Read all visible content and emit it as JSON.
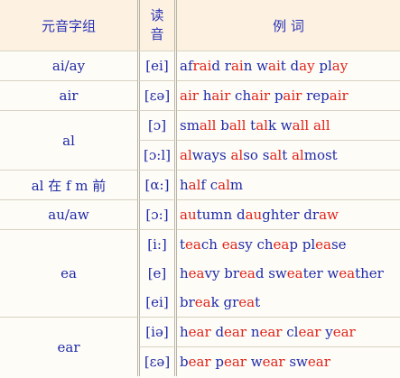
{
  "header": {
    "col1": "元音字组",
    "col2a": "读",
    "col2b": "音",
    "col3": "例  词"
  },
  "rows": [
    {
      "cat": "ai/ay",
      "ph": "[ei]",
      "ex": [
        [
          "af",
          0
        ],
        [
          "rai",
          1
        ],
        [
          "d r",
          0
        ],
        [
          "ai",
          1
        ],
        [
          "n w",
          0
        ],
        [
          "ai",
          1
        ],
        [
          "t d",
          0
        ],
        [
          "ay",
          1
        ],
        [
          " pl",
          0
        ],
        [
          "ay",
          1
        ]
      ]
    },
    {
      "cat": "air",
      "ph": "[εə]",
      "ex": [
        [
          "air",
          1
        ],
        [
          " h",
          0
        ],
        [
          "air",
          1
        ],
        [
          " ch",
          0
        ],
        [
          "air",
          1
        ],
        [
          " p",
          0
        ],
        [
          "air",
          1
        ],
        [
          " rep",
          0
        ],
        [
          "air",
          1
        ]
      ]
    },
    {
      "cat": "al",
      "ph": "[ɔ]",
      "ex": [
        [
          "sm",
          0
        ],
        [
          "all",
          1
        ],
        [
          " b",
          0
        ],
        [
          "all",
          1
        ],
        [
          " t",
          0
        ],
        [
          "al",
          1
        ],
        [
          "k w",
          0
        ],
        [
          "all",
          1
        ],
        [
          " ",
          0
        ],
        [
          "all",
          1
        ]
      ]
    },
    {
      "cat": "",
      "ph": "[ɔ:l]",
      "ex": [
        [
          "al",
          1
        ],
        [
          "ways ",
          0
        ],
        [
          "al",
          1
        ],
        [
          "so s",
          0
        ],
        [
          "al",
          1
        ],
        [
          "t ",
          0
        ],
        [
          "al",
          1
        ],
        [
          "most",
          0
        ]
      ]
    },
    {
      "cat": "al 在 f m 前",
      "ph": "[α:]",
      "ex": [
        [
          "h",
          0
        ],
        [
          "al",
          1
        ],
        [
          "f c",
          0
        ],
        [
          "al",
          1
        ],
        [
          "m",
          0
        ]
      ]
    },
    {
      "cat": "au/aw",
      "ph": "[ɔ:]",
      "ex": [
        [
          "au",
          1
        ],
        [
          "tumn d",
          0
        ],
        [
          "au",
          1
        ],
        [
          "ghter dr",
          0
        ],
        [
          "aw",
          1
        ]
      ]
    },
    {
      "cat": "ea",
      "ph": "[i:]",
      "ex": [
        [
          "t",
          0
        ],
        [
          "ea",
          1
        ],
        [
          "ch ",
          0
        ],
        [
          "ea",
          1
        ],
        [
          "sy ch",
          0
        ],
        [
          "ea",
          1
        ],
        [
          "p pl",
          0
        ],
        [
          "ea",
          1
        ],
        [
          "se",
          0
        ]
      ]
    },
    {
      "cat": "",
      "ph": "[e]",
      "ex": [
        [
          "h",
          0
        ],
        [
          "ea",
          1
        ],
        [
          "vy br",
          0
        ],
        [
          "ea",
          1
        ],
        [
          "d sw",
          0
        ],
        [
          "ea",
          1
        ],
        [
          "ter w",
          0
        ],
        [
          "ea",
          1
        ],
        [
          "ther",
          0
        ]
      ]
    },
    {
      "cat": "",
      "ph": "[ei]",
      "ex": [
        [
          "br",
          0
        ],
        [
          "ea",
          1
        ],
        [
          "k gr",
          0
        ],
        [
          "ea",
          1
        ],
        [
          "t",
          0
        ]
      ]
    },
    {
      "cat": "ear",
      "ph": "[iə]",
      "ex": [
        [
          "h",
          0
        ],
        [
          "ear",
          1
        ],
        [
          " d",
          0
        ],
        [
          "ear",
          1
        ],
        [
          " n",
          0
        ],
        [
          "ear",
          1
        ],
        [
          " cl",
          0
        ],
        [
          "ear",
          1
        ],
        [
          " y",
          0
        ],
        [
          "ear",
          1
        ]
      ]
    },
    {
      "cat": "",
      "ph": "[εə]",
      "ex": [
        [
          "b",
          0
        ],
        [
          "ear",
          1
        ],
        [
          " p",
          0
        ],
        [
          "ear",
          1
        ],
        [
          " w",
          0
        ],
        [
          "ear",
          1
        ],
        [
          " sw",
          0
        ],
        [
          "ear",
          1
        ]
      ]
    }
  ],
  "colors": {
    "accent": "#e0231b",
    "text": "#1f2aa8",
    "header_bg": "#fdf2e2"
  }
}
